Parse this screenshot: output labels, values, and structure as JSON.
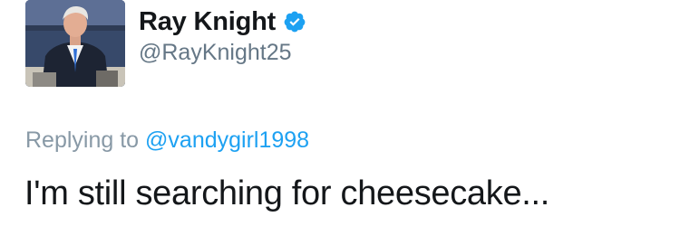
{
  "author": {
    "display_name": "Ray Knight",
    "handle": "@RayKnight25",
    "verified": true,
    "avatar_icon": "profile-photo"
  },
  "reply": {
    "prefix": "Replying to",
    "mention": "@vandygirl1998"
  },
  "tweet": {
    "text": "I'm still searching for cheesecake..."
  },
  "colors": {
    "name": "#14171a",
    "handle": "#657786",
    "reply_prefix": "#8899a6",
    "mention": "#1da1f2",
    "verified_badge": "#1da1f2"
  }
}
